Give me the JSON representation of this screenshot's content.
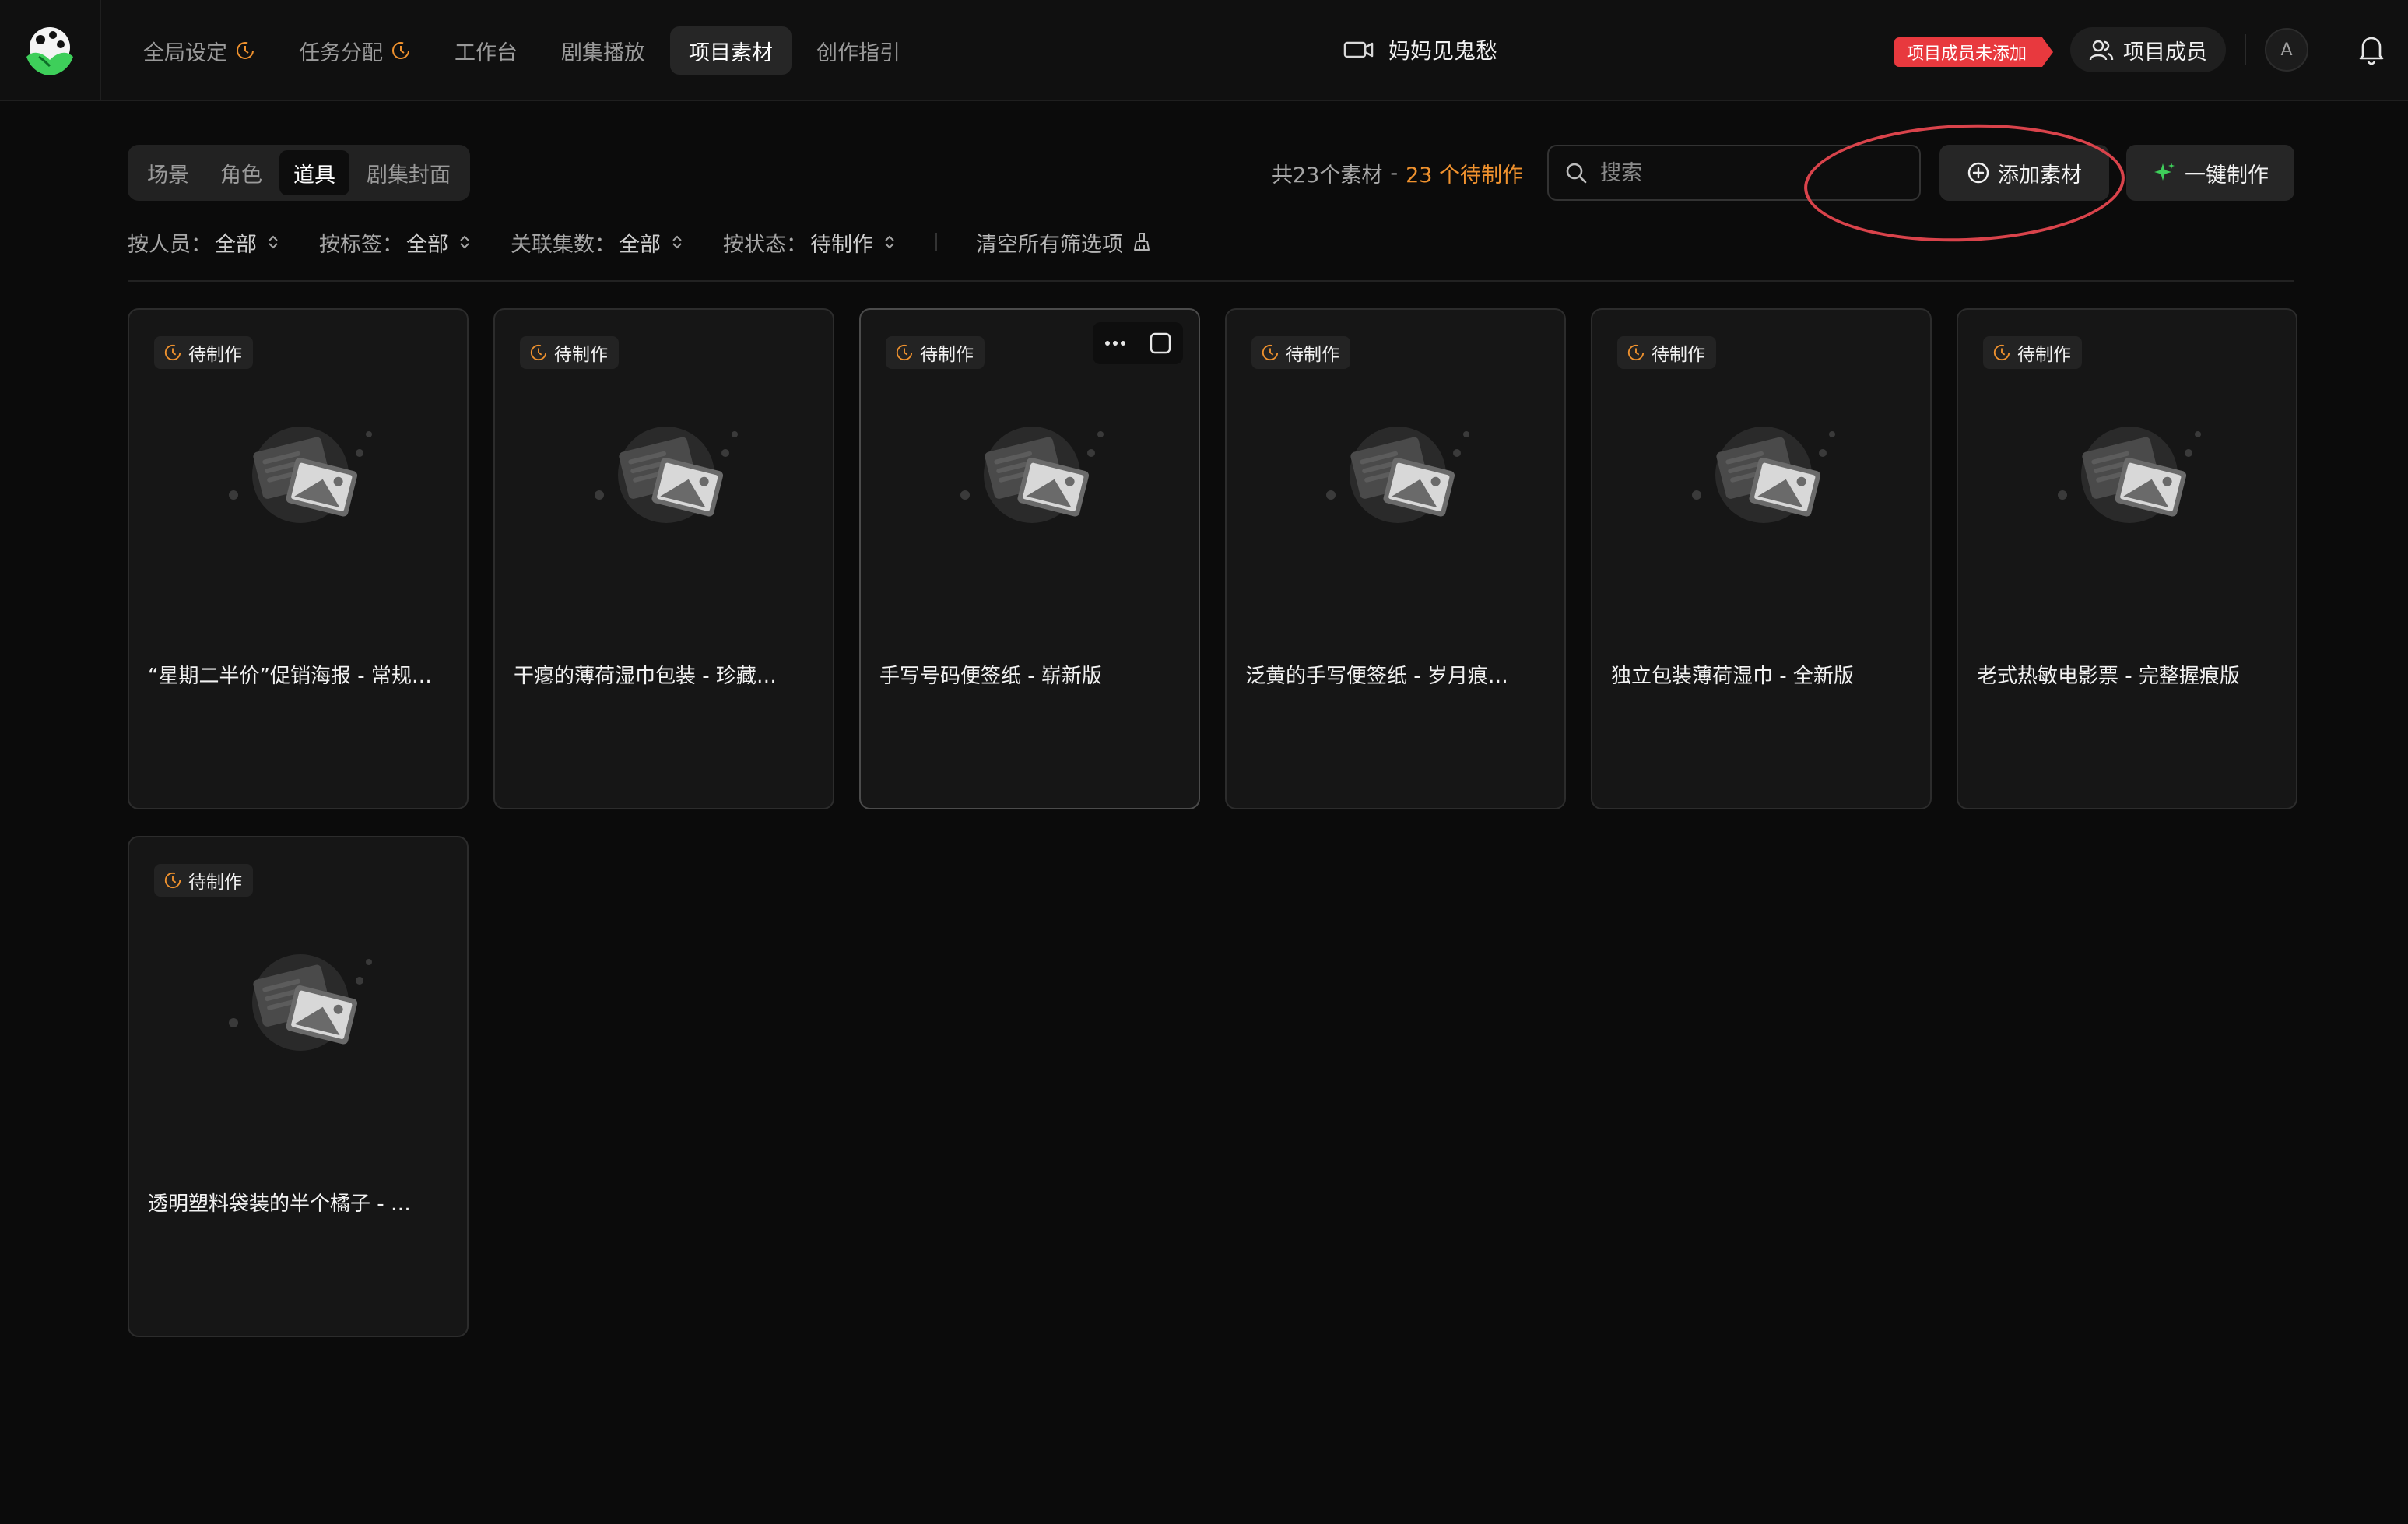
{
  "nav": {
    "items": [
      {
        "label": "全局设定",
        "has_status": true,
        "active": false
      },
      {
        "label": "任务分配",
        "has_status": true,
        "active": false
      },
      {
        "label": "工作台",
        "has_status": false,
        "active": false
      },
      {
        "label": "剧集播放",
        "has_status": false,
        "active": false
      },
      {
        "label": "项目素材",
        "has_status": false,
        "active": true
      },
      {
        "label": "创作指引",
        "has_status": false,
        "active": false
      }
    ]
  },
  "project": {
    "title": "妈妈见鬼愁",
    "icon": "video-camera-icon"
  },
  "header": {
    "member_notice": "项目成员未添加",
    "members_label": "项目成员",
    "avatar_initial": "A"
  },
  "tabs": [
    {
      "label": "场景",
      "active": false
    },
    {
      "label": "角色",
      "active": false
    },
    {
      "label": "道具",
      "active": true
    },
    {
      "label": "剧集封面",
      "active": false
    }
  ],
  "summary": {
    "total": "共23个素材",
    "separator": "-",
    "pending": "23 个待制作"
  },
  "search": {
    "placeholder": "搜索",
    "value": ""
  },
  "actions": {
    "add_label": "添加素材",
    "auto_label": "一键制作"
  },
  "filters": [
    {
      "label": "按人员：",
      "value": "全部"
    },
    {
      "label": "按标签：",
      "value": "全部"
    },
    {
      "label": "关联集数：",
      "value": "全部"
    },
    {
      "label": "按状态：",
      "value": "待制作"
    }
  ],
  "clear_filters_label": "清空所有筛选项",
  "cards": [
    {
      "status": "待制作",
      "title": "“星期二半价”促销海报 - 常规…",
      "hover": false
    },
    {
      "status": "待制作",
      "title": "干瘪的薄荷湿巾包装 - 珍藏…",
      "hover": false
    },
    {
      "status": "待制作",
      "title": "手写号码便签纸 - 崭新版",
      "hover": true
    },
    {
      "status": "待制作",
      "title": "泛黄的手写便签纸 - 岁月痕…",
      "hover": false
    },
    {
      "status": "待制作",
      "title": "独立包装薄荷湿巾 - 全新版",
      "hover": false
    },
    {
      "status": "待制作",
      "title": "老式热敏电影票 - 完整握痕版",
      "hover": false
    },
    {
      "status": "待制作",
      "title": "透明塑料袋装的半个橘子 - …",
      "hover": false
    }
  ],
  "colors": {
    "accent_orange": "#f0922e",
    "notice_red": "#e8393e",
    "sparkle_green": "#3ecf5a",
    "annotation_circle": "#d9434b",
    "background": "#0b0b0b"
  }
}
